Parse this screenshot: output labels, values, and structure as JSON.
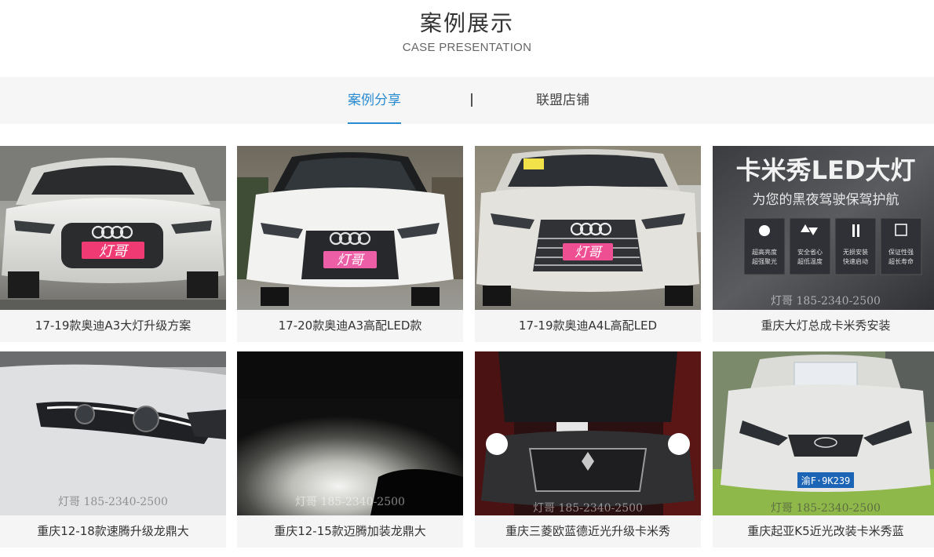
{
  "header": {
    "title": "案例展示",
    "subtitle": "CASE PRESENTATION"
  },
  "tabs": [
    {
      "label": "案例分享",
      "active": true
    },
    {
      "label": "联盟店铺",
      "active": false
    }
  ],
  "accent_color": "#2a8bd0",
  "cards": [
    {
      "caption": "17-19款奥迪A3大灯升级方案",
      "plate": "灯哥"
    },
    {
      "caption": "17-20款奥迪A3高配LED款",
      "plate": "灯哥"
    },
    {
      "caption": "17-19款奥迪A4L高配LED",
      "plate": "灯哥"
    },
    {
      "caption": "重庆大灯总成卡米秀安装",
      "banner_title": "卡米秀LED大灯",
      "banner_sub": "为您的黑夜驾驶保驾护航",
      "features": [
        {
          "icon": "sun-icon",
          "line1": "超高亮度",
          "line2": "超强聚光"
        },
        {
          "icon": "recycle-icon",
          "line1": "安全省心",
          "line2": "超低温度"
        },
        {
          "icon": "tools-icon",
          "line1": "无损安装",
          "line2": "快速启动"
        },
        {
          "icon": "calendar-icon",
          "line1": "保证性强",
          "line2": "超长寿命"
        }
      ],
      "watermark": "灯哥 185-2340-2500"
    },
    {
      "caption": "重庆12-18款速腾升级龙鼎大",
      "watermark": "灯哥 185-2340-2500"
    },
    {
      "caption": "重庆12-15款迈腾加装龙鼎大",
      "watermark": "灯哥 185-2340-2500"
    },
    {
      "caption": "重庆三菱欧蓝德近光升级卡米秀",
      "watermark": "灯哥 185-2340-2500"
    },
    {
      "caption": "重庆起亚K5近光改装卡米秀蓝",
      "plate": "渝F·9K239",
      "watermark": "灯哥 185-2340-2500"
    }
  ]
}
